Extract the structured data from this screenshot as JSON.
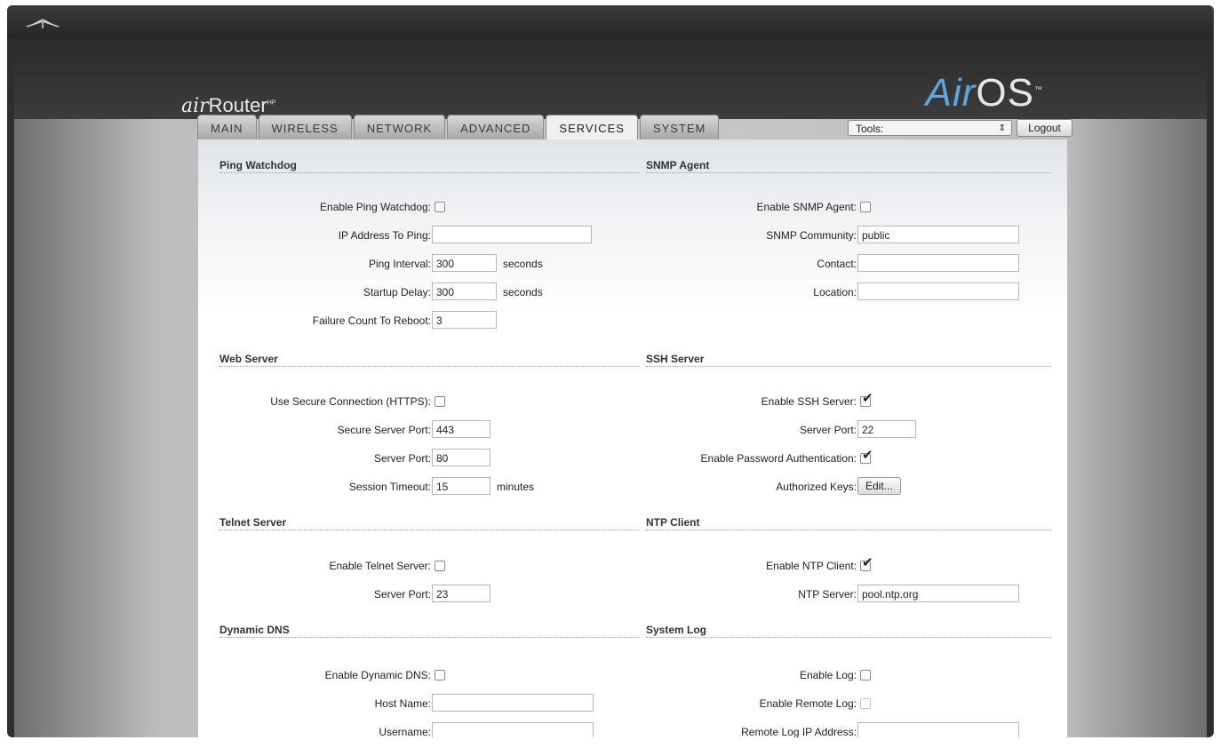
{
  "header": {
    "brand_prefix": "air",
    "brand_name": "Router",
    "brand_suffix": "HP",
    "logo_air": "Air",
    "logo_os": "OS",
    "logo_tm": "™"
  },
  "tabs": [
    {
      "label": "MAIN"
    },
    {
      "label": "WIRELESS"
    },
    {
      "label": "NETWORK"
    },
    {
      "label": "ADVANCED"
    },
    {
      "label": "SERVICES"
    },
    {
      "label": "SYSTEM"
    }
  ],
  "tools": {
    "label": "Tools:",
    "arrows": "⇕"
  },
  "logout_label": "Logout",
  "ping_watchdog": {
    "title": "Ping Watchdog",
    "enable_label": "Enable Ping Watchdog:",
    "enable_checked": false,
    "ip_label": "IP Address To Ping:",
    "ip_value": "",
    "interval_label": "Ping Interval:",
    "interval_value": "300",
    "interval_unit": "seconds",
    "delay_label": "Startup Delay:",
    "delay_value": "300",
    "delay_unit": "seconds",
    "failure_label": "Failure Count To Reboot:",
    "failure_value": "3"
  },
  "snmp": {
    "title": "SNMP Agent",
    "enable_label": "Enable SNMP Agent:",
    "enable_checked": false,
    "community_label": "SNMP Community:",
    "community_value": "public",
    "contact_label": "Contact:",
    "contact_value": "",
    "location_label": "Location:",
    "location_value": ""
  },
  "web_server": {
    "title": "Web Server",
    "https_label": "Use Secure Connection (HTTPS):",
    "https_checked": false,
    "secure_port_label": "Secure Server Port:",
    "secure_port_value": "443",
    "port_label": "Server Port:",
    "port_value": "80",
    "timeout_label": "Session Timeout:",
    "timeout_value": "15",
    "timeout_unit": "minutes"
  },
  "ssh_server": {
    "title": "SSH Server",
    "enable_label": "Enable SSH Server:",
    "enable_checked": true,
    "port_label": "Server Port:",
    "port_value": "22",
    "password_auth_label": "Enable Password Authentication:",
    "password_auth_checked": true,
    "keys_label": "Authorized Keys:",
    "keys_button": "Edit..."
  },
  "telnet_server": {
    "title": "Telnet Server",
    "enable_label": "Enable Telnet Server:",
    "enable_checked": false,
    "port_label": "Server Port:",
    "port_value": "23"
  },
  "ntp_client": {
    "title": "NTP Client",
    "enable_label": "Enable NTP Client:",
    "enable_checked": true,
    "server_label": "NTP Server:",
    "server_value": "pool.ntp.org"
  },
  "dynamic_dns": {
    "title": "Dynamic DNS",
    "enable_label": "Enable Dynamic DNS:",
    "enable_checked": false,
    "host_label": "Host Name:",
    "host_value": "",
    "user_label": "Username:",
    "user_value": ""
  },
  "system_log": {
    "title": "System Log",
    "enable_label": "Enable Log:",
    "enable_checked": false,
    "remote_label": "Enable Remote Log:",
    "remote_checked": false,
    "remote_ip_label": "Remote Log IP Address:",
    "remote_ip_value": ""
  },
  "check_glyph": "✔"
}
